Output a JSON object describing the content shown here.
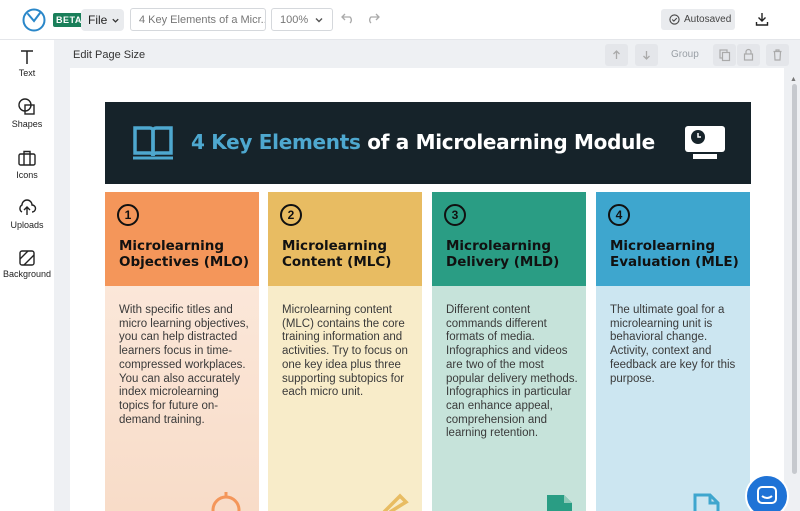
{
  "topbar": {
    "beta": "BETA",
    "file": "File",
    "doc_title": "4 Key Elements of a Micr...",
    "zoom": "100%",
    "autosaved": "Autosaved"
  },
  "sidebar": {
    "items": [
      {
        "label": "Text",
        "icon": "text-icon"
      },
      {
        "label": "Shapes",
        "icon": "shapes-icon"
      },
      {
        "label": "Icons",
        "icon": "briefcase-icon"
      },
      {
        "label": "Uploads",
        "icon": "upload-icon"
      },
      {
        "label": "Background",
        "icon": "background-icon"
      }
    ]
  },
  "page_toolbar": {
    "edit_size": "Edit Page Size",
    "group": "Group"
  },
  "infographic": {
    "title_accent": "4 Key Elements",
    "title_rest": " of a Microlearning Module",
    "columns": [
      {
        "num": "1",
        "title": "Microlearning Objectives (MLO)",
        "text": "With specific titles and micro learning objectives, you can help distracted learners focus in time-compressed workplaces. You can also accurately index microlearning topics for future on-demand training.",
        "head_color": "#f4965a",
        "body_color": "#f9e4d6"
      },
      {
        "num": "2",
        "title": "Microlearning Content (MLC)",
        "text": "Microlearning content (MLC) contains the core training information and activities. Try to focus on one key idea plus three supporting subtopics for each micro unit.",
        "head_color": "#e8bc62",
        "body_color": "#f8ecc9"
      },
      {
        "num": "3",
        "title": "Microlearning Delivery (MLD)",
        "text": "Different content commands different formats of media. Infographics and videos are two of the most popular delivery methods. Infographics in particular can enhance appeal, comprehension and learning retention.",
        "head_color": "#2a9d84",
        "body_color": "#c6e3da"
      },
      {
        "num": "4",
        "title": "Microlearning Evaluation (MLE)",
        "text": "The ultimate goal for a microlearning unit is behavioral change. Activity, context and feedback are key for this purpose.",
        "head_color": "#3ea6ce",
        "body_color": "#cce6f1"
      }
    ]
  },
  "colors": {
    "banner_bg": "#16232a",
    "accent_blue": "#4ea8cf",
    "brand_green": "#1a7f5a"
  }
}
